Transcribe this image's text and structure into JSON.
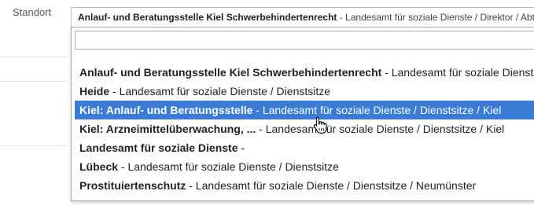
{
  "field": {
    "label": "Standort"
  },
  "select": {
    "selected_bold": "Anlauf- und Beratungsstelle Kiel Schwerbehindertenrecht",
    "selected_rest": " - Landesamt für soziale Dienste / Direktor / Abte",
    "search_value": ""
  },
  "options": [
    {
      "bold": "Anlauf- und Beratungsstelle Kiel Schwerbehindertenrecht",
      "rest": " - Landesamt für soziale Dienste"
    },
    {
      "bold": "Heide",
      "rest": " - Landesamt für soziale Dienste / Dienstsitze"
    },
    {
      "bold": "Kiel: Anlauf- und Beratungsstelle",
      "rest": " - Landesamt für soziale Dienste / Dienstsitze / Kiel",
      "highlighted": true
    },
    {
      "bold": "Kiel: Arzneimittelüberwachung, ...",
      "rest": " - Landesamt für soziale Dienste / Dienstsitze / Kiel"
    },
    {
      "bold": "Landesamt für soziale Dienste",
      "rest": " -"
    },
    {
      "bold": "Lübeck",
      "rest": " - Landesamt für soziale Dienste / Dienstsitze"
    },
    {
      "bold": "Prostituiertenschutz",
      "rest": " - Landesamt für soziale Dienste / Dienstsitze / Neumünster"
    }
  ],
  "colors": {
    "highlight": "#3a7bd5"
  },
  "icons": {
    "cursor": "hand-pointer-icon"
  }
}
